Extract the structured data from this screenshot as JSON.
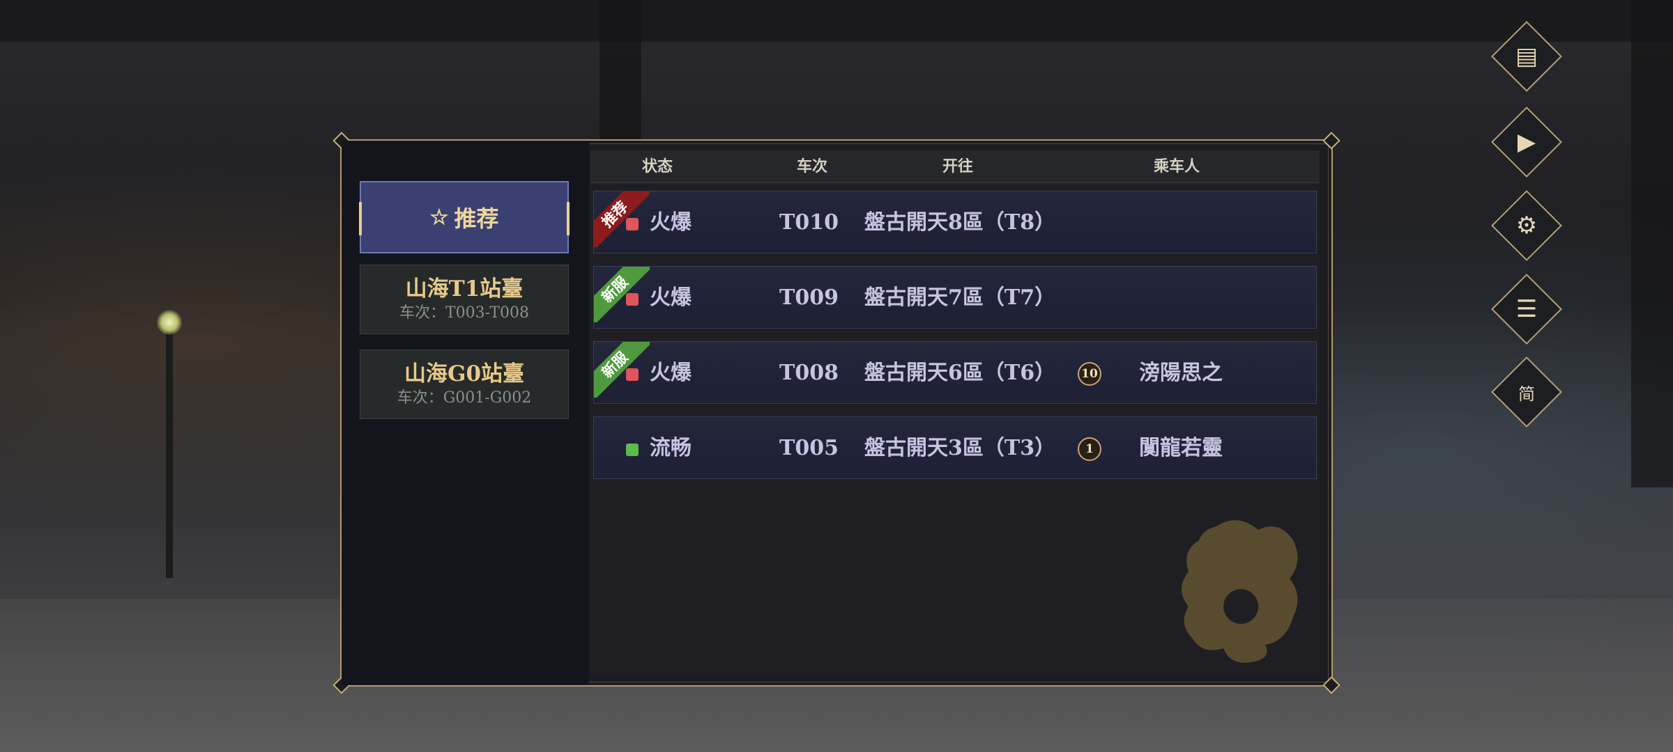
{
  "sidebar": {
    "recommended_label": "推荐",
    "servers": [
      {
        "name": "山海T1站臺",
        "range": "车次：T003-T008"
      },
      {
        "name": "山海G0站臺",
        "range": "车次：G001-G002"
      }
    ]
  },
  "table": {
    "headers": {
      "status": "状态",
      "train": "车次",
      "destination": "开往",
      "passenger": "乘车人"
    },
    "rows": [
      {
        "ribbon": "推荐",
        "ribbon_color": "#8c1c1c",
        "status_color": "#e0545c",
        "status": "火爆",
        "train": "T010",
        "destination": "盤古開天8區（T8）",
        "level": "",
        "passenger": ""
      },
      {
        "ribbon": "新服",
        "ribbon_color": "#4f9a3e",
        "status_color": "#e0545c",
        "status": "火爆",
        "train": "T009",
        "destination": "盤古開天7區（T7）",
        "level": "",
        "passenger": ""
      },
      {
        "ribbon": "新服",
        "ribbon_color": "#4f9a3e",
        "status_color": "#e0545c",
        "status": "火爆",
        "train": "T008",
        "destination": "盤古開天6區（T6）",
        "level": "10",
        "passenger": "滂陽思之"
      },
      {
        "ribbon": "",
        "ribbon_color": "",
        "status_color": "#5cbd4a",
        "status": "流畅",
        "train": "T005",
        "destination": "盤古開天3區（T3）",
        "level": "1",
        "passenger": "闃龍若靈"
      }
    ]
  },
  "side_buttons": [
    {
      "icon": "notice-icon",
      "glyph": "▤"
    },
    {
      "icon": "video-icon",
      "glyph": "▶"
    },
    {
      "icon": "repair-icon",
      "glyph": "⚙"
    },
    {
      "icon": "profile-icon",
      "glyph": "☰"
    },
    {
      "icon": "language-icon",
      "glyph": "简"
    }
  ],
  "colors": {
    "accent_gold": "#c9ad7a",
    "selected_tab": "#3a4172",
    "hot": "#e0545c",
    "smooth": "#5cbd4a"
  }
}
